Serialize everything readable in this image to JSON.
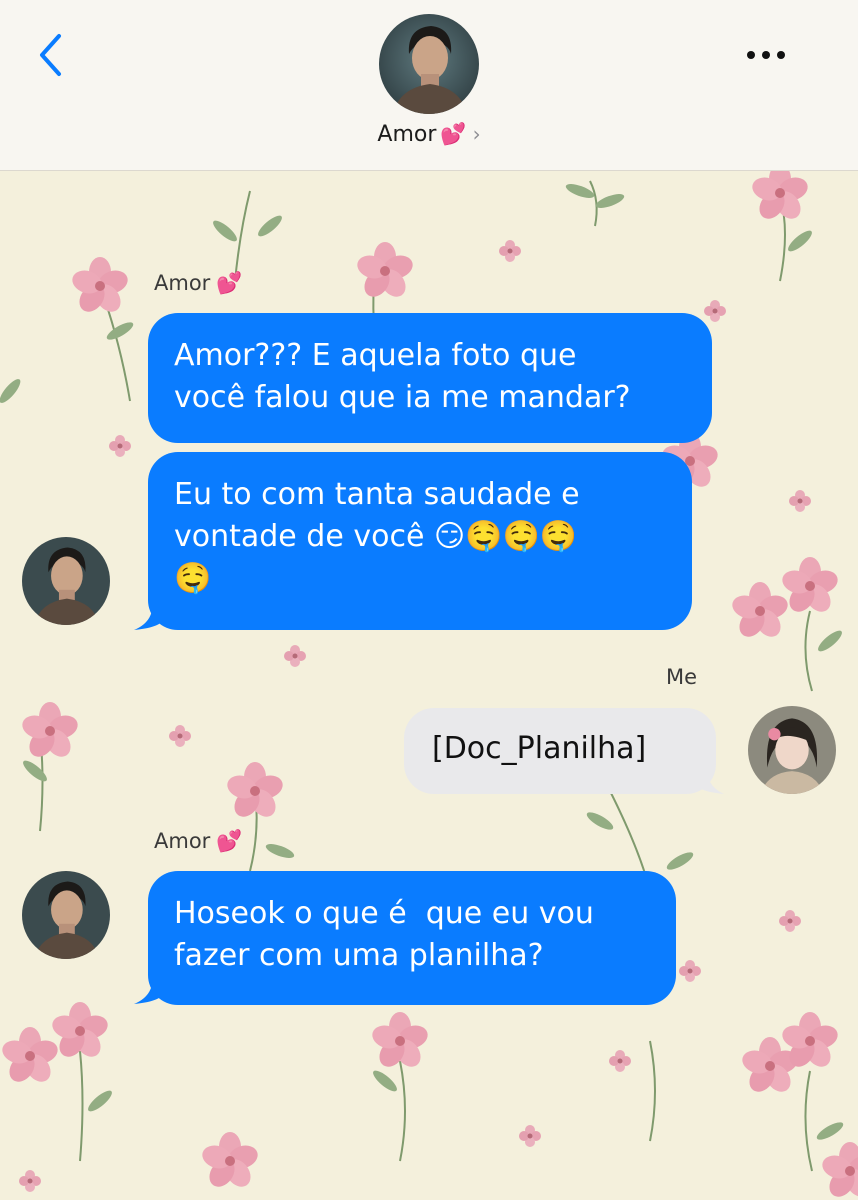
{
  "header": {
    "contact_name": "Amor",
    "contact_emoji": "💕",
    "chevron": "›",
    "back_icon": "chevron-left-icon",
    "more_icon": "ellipsis-icon",
    "accent_color": "#0a7cff"
  },
  "messages": [
    {
      "from": "Amor",
      "label": "Amor",
      "label_emoji": "💕",
      "direction": "incoming",
      "text": "Amor??? E aquela foto que você falou que ia me mandar?"
    },
    {
      "from": "Amor",
      "direction": "incoming",
      "text": "Eu to com tanta saudade e vontade de você 😏🤤🤤🤤🤤"
    },
    {
      "from": "Me",
      "label": "Me",
      "direction": "outgoing",
      "text": "[Doc_Planilha]"
    },
    {
      "from": "Amor",
      "label": "Amor",
      "label_emoji": "💕",
      "direction": "incoming",
      "text": "Hoseok o que é  que eu vou fazer com uma planilha?"
    }
  ],
  "display": {
    "m1_line1": "Amor??? E aquela foto que",
    "m1_line2": "você falou que ia me mandar?",
    "m2_line1": "Eu to com tanta saudade e",
    "m2_line2": "vontade de você 😏🤤🤤🤤",
    "m2_line3": "🤤",
    "m4_line1": "Hoseok o que é  que eu vou",
    "m4_line2": "fazer com uma planilha?"
  },
  "colors": {
    "incoming_bubble": "#0a7cff",
    "outgoing_bubble": "#e9e9eb",
    "wallpaper": "#f4f0dc",
    "flower_pink": "#e9a3b3",
    "leaf_green": "#8aa67a"
  }
}
